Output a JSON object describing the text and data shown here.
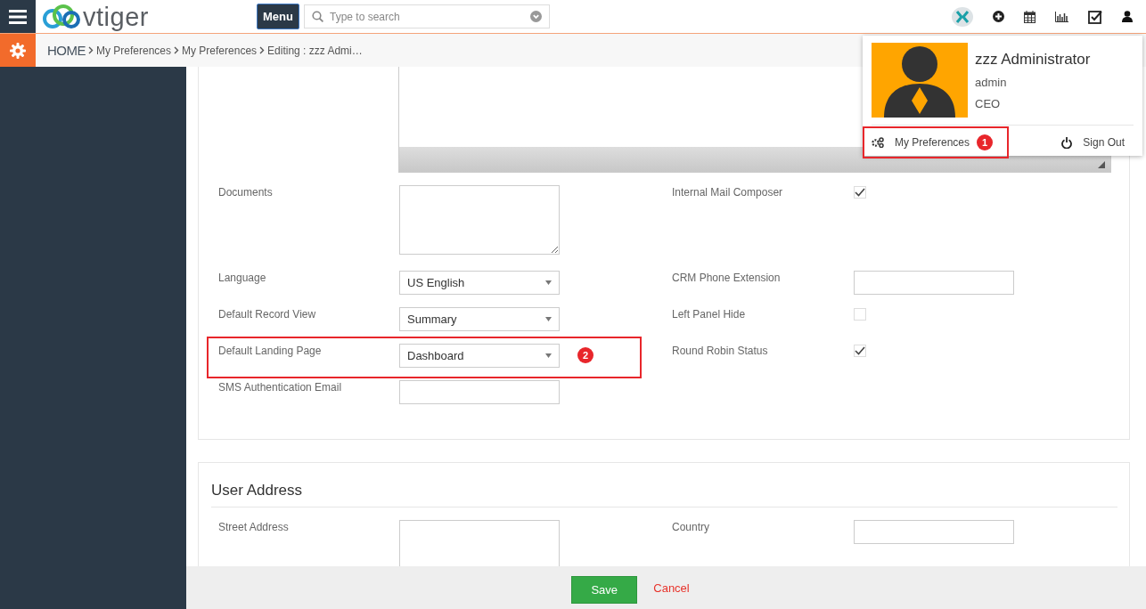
{
  "topbar": {
    "logo": "vtiger",
    "menu_button": "Menu",
    "search": {
      "placeholder": "Type to search"
    }
  },
  "breadcrumb": [
    {
      "text": "HOME",
      "kind": "home"
    },
    {
      "text": "My Preferences",
      "kind": "link"
    },
    {
      "text": "My Preferences",
      "kind": "link"
    },
    {
      "text": "Editing : zzz Admi…",
      "kind": "current"
    }
  ],
  "user_menu": {
    "name": "zzz Administrator",
    "username": "admin",
    "role": "CEO",
    "links": [
      {
        "label": "My Preferences",
        "kind": "preferences",
        "callout": "1"
      },
      {
        "label": "Sign Out",
        "kind": "signout"
      }
    ]
  },
  "sections": [
    {
      "rows": [
        [
          {
            "label": "Documents",
            "kind": "textarea"
          },
          {
            "label": "Internal Mail Composer",
            "kind": "checkbox",
            "checked": true
          }
        ],
        [
          {
            "label": "Language",
            "kind": "select",
            "value": "US English"
          },
          {
            "label": "CRM Phone Extension",
            "kind": "text"
          }
        ],
        [
          {
            "label": "Default Record View",
            "kind": "select",
            "value": "Summary"
          },
          {
            "label": "Left Panel Hide",
            "kind": "checkbox",
            "checked": false
          }
        ],
        [
          {
            "label": "Default Landing Page",
            "kind": "select",
            "value": "Dashboard",
            "callout": "2"
          },
          {
            "label": "Round Robin Status",
            "kind": "checkbox",
            "checked": true
          }
        ],
        [
          {
            "label": "SMS Authentication Email",
            "kind": "text"
          }
        ]
      ]
    },
    {
      "title": "User Address",
      "rows": [
        [
          {
            "label": "Street Address",
            "kind": "textarea"
          },
          {
            "label": "Country",
            "kind": "text"
          }
        ]
      ]
    }
  ],
  "footer": {
    "save": "Save",
    "cancel": "Cancel"
  }
}
